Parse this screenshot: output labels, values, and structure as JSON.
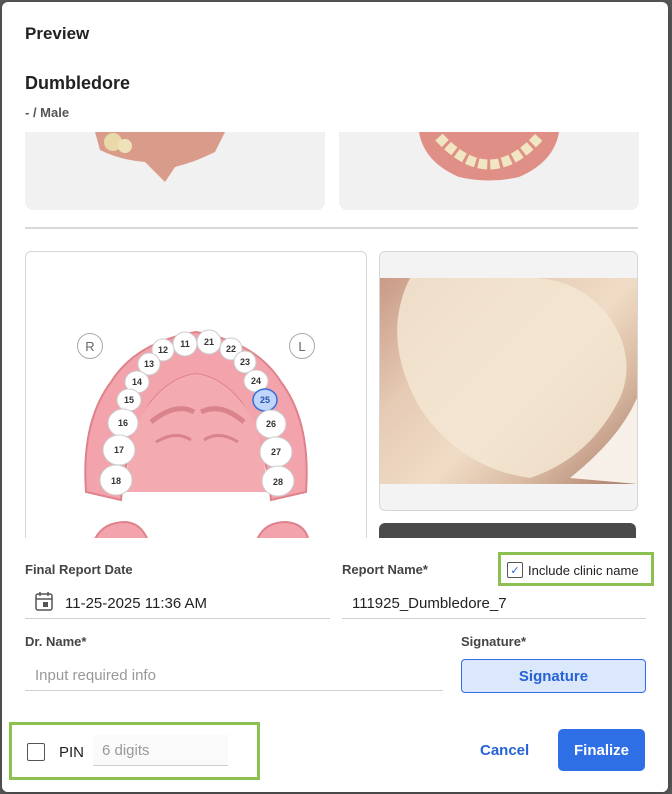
{
  "dialog": {
    "title": "Preview",
    "patient_name": "Dumbledore",
    "patient_info": "- / Male"
  },
  "tooth_chart": {
    "right_label": "R",
    "left_label": "L",
    "teeth": [
      "11",
      "21",
      "12",
      "22",
      "13",
      "23",
      "14",
      "24",
      "15",
      "25",
      "16",
      "26",
      "17",
      "27",
      "18",
      "28"
    ],
    "selected": "25"
  },
  "form": {
    "final_report_date_label": "Final Report Date",
    "final_report_date_value": "11-25-2025 11:36 AM",
    "report_name_label": "Report Name*",
    "report_name_value": "111925_Dumbledore_7",
    "include_clinic_label": "Include clinic name",
    "include_clinic_checked": true,
    "dr_name_label": "Dr. Name*",
    "dr_name_placeholder": "Input required info",
    "signature_label": "Signature*",
    "signature_button": "Signature",
    "pin_label": "PIN",
    "pin_placeholder": "6 digits"
  },
  "actions": {
    "cancel": "Cancel",
    "finalize": "Finalize"
  },
  "colors": {
    "accent": "#2f6fe6",
    "highlight": "#8cc152",
    "gum": "#f2a3ab"
  }
}
